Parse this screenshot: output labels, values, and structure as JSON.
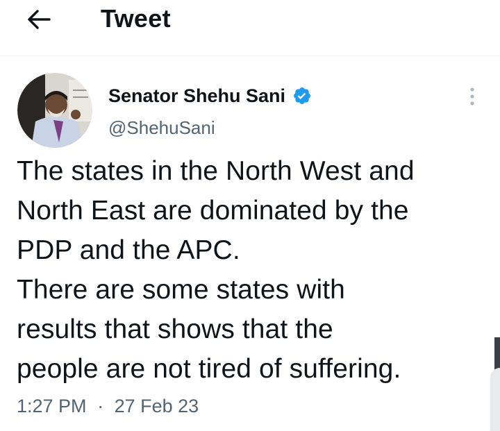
{
  "header": {
    "back_icon": "arrow-left-icon",
    "title": "Tweet"
  },
  "tweet": {
    "author": {
      "name": "Senator Shehu Sani",
      "handle": "@ShehuSani",
      "verified": true,
      "verified_icon": "verified-badge-icon",
      "verified_color": "#1d9bf0"
    },
    "more_icon": "more-vertical-icon",
    "text_lines": [
      "The states in the North West and",
      "North East are dominated by the",
      "PDP and the APC.",
      "There are some states with",
      "results that shows that the",
      "people are not tired of suffering."
    ],
    "time": "1:27 PM",
    "separator": "·",
    "date": "27 Feb 23"
  },
  "colors": {
    "text_primary": "#0f1419",
    "text_secondary": "#536471",
    "divider": "#eff3f4"
  }
}
